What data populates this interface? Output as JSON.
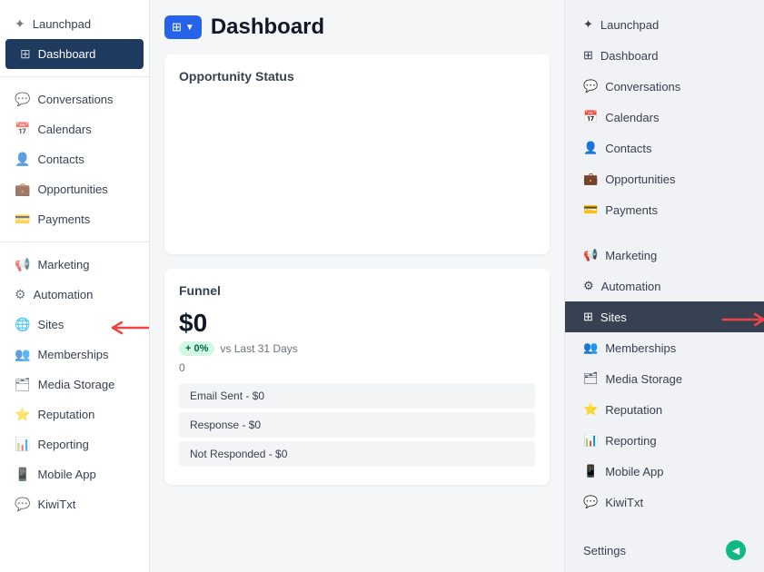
{
  "header": {
    "title": "Dashboard",
    "icon_label": "dashboard-icon"
  },
  "left_sidebar": {
    "items_top": [
      {
        "id": "launchpad",
        "label": "Launchpad",
        "icon": "🚀",
        "active": false
      },
      {
        "id": "dashboard",
        "label": "Dashboard",
        "icon": "⊞",
        "active": true
      }
    ],
    "items_mid": [
      {
        "id": "conversations",
        "label": "Conversations",
        "icon": "💬",
        "active": false
      },
      {
        "id": "calendars",
        "label": "Calendars",
        "icon": "📅",
        "active": false
      },
      {
        "id": "contacts",
        "label": "Contacts",
        "icon": "👤",
        "active": false
      },
      {
        "id": "opportunities",
        "label": "Opportunities",
        "icon": "💼",
        "active": false
      },
      {
        "id": "payments",
        "label": "Payments",
        "icon": "💳",
        "active": false
      }
    ],
    "items_bottom": [
      {
        "id": "marketing",
        "label": "Marketing",
        "icon": "📢",
        "active": false
      },
      {
        "id": "automation",
        "label": "Automation",
        "icon": "⚙",
        "active": false
      },
      {
        "id": "sites",
        "label": "Sites",
        "icon": "🌐",
        "active": false,
        "has_arrow": true
      },
      {
        "id": "memberships",
        "label": "Memberships",
        "icon": "👥",
        "active": false
      },
      {
        "id": "media-storage",
        "label": "Media Storage",
        "icon": "🗂",
        "active": false
      },
      {
        "id": "reputation",
        "label": "Reputation",
        "icon": "⭐",
        "active": false
      },
      {
        "id": "reporting",
        "label": "Reporting",
        "icon": "📊",
        "active": false
      },
      {
        "id": "mobile-app",
        "label": "Mobile App",
        "icon": "📱",
        "active": false
      },
      {
        "id": "kiwitxt",
        "label": "KiwiTxt",
        "icon": "💬",
        "active": false
      }
    ]
  },
  "main": {
    "opportunity_status_title": "Opportunity Status",
    "funnel_title": "Funnel",
    "funnel_amount": "$0",
    "funnel_badge": "+ 0%",
    "funnel_vs": "vs Last 31 Days",
    "funnel_zero": "0",
    "funnel_rows": [
      {
        "label": "Email Sent  - $0"
      },
      {
        "label": "Response - $0"
      },
      {
        "label": "Not Responded - $0"
      }
    ]
  },
  "right_panel": {
    "items_top": [
      {
        "id": "launchpad",
        "label": "Launchpad",
        "icon": "🚀",
        "active": false
      },
      {
        "id": "dashboard",
        "label": "Dashboard",
        "icon": "⊞",
        "active": false
      },
      {
        "id": "conversations",
        "label": "Conversations",
        "icon": "💬",
        "active": false
      },
      {
        "id": "calendars",
        "label": "Calendars",
        "icon": "📅",
        "active": false
      },
      {
        "id": "contacts",
        "label": "Contacts",
        "icon": "👤",
        "active": false
      },
      {
        "id": "opportunities",
        "label": "Opportunities",
        "icon": "💼",
        "active": false
      },
      {
        "id": "payments",
        "label": "Payments",
        "icon": "💳",
        "active": false
      }
    ],
    "items_mid": [
      {
        "id": "marketing",
        "label": "Marketing",
        "icon": "📢",
        "active": false
      },
      {
        "id": "automation",
        "label": "Automation",
        "icon": "⚙",
        "active": false
      },
      {
        "id": "sites",
        "label": "Sites",
        "icon": "🌐",
        "active": true
      },
      {
        "id": "memberships",
        "label": "Memberships",
        "icon": "👥",
        "active": false
      },
      {
        "id": "media-storage",
        "label": "Media Storage",
        "icon": "🗂",
        "active": false
      },
      {
        "id": "reputation",
        "label": "Reputation",
        "icon": "⭐",
        "active": false
      },
      {
        "id": "reporting",
        "label": "Reporting",
        "icon": "📊",
        "active": false
      },
      {
        "id": "mobile-app",
        "label": "Mobile App",
        "icon": "📱",
        "active": false
      },
      {
        "id": "kiwitxt",
        "label": "KiwiTxt",
        "icon": "💬",
        "active": false
      }
    ],
    "settings_label": "Settings"
  }
}
